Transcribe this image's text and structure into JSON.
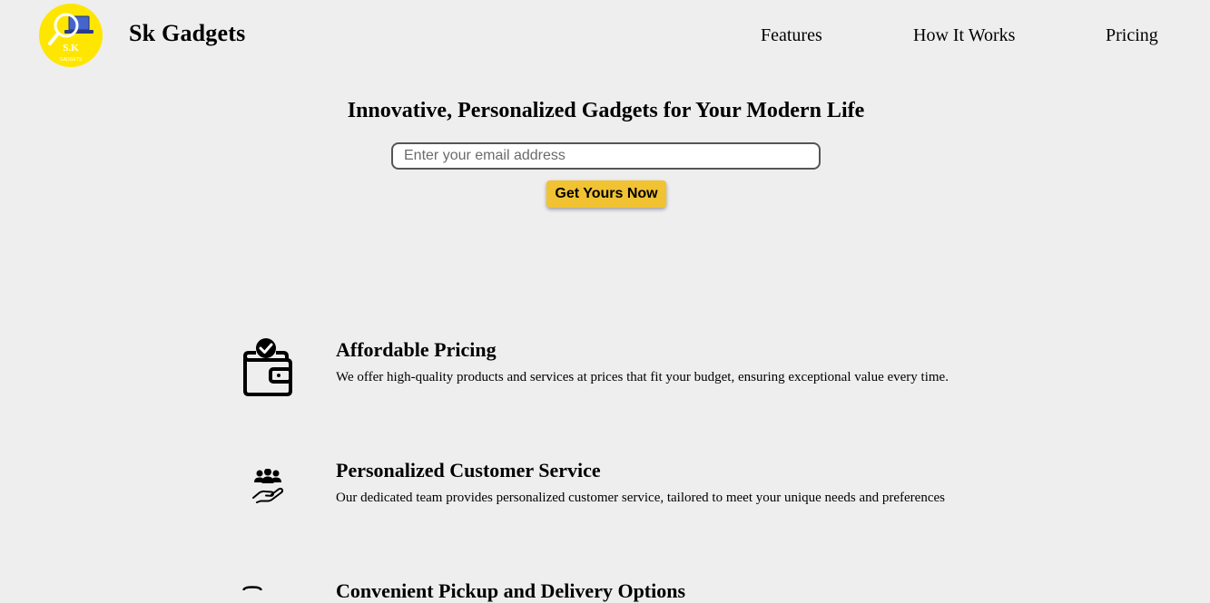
{
  "header": {
    "logo_text": "S.K",
    "logo_subtext": "GADGETS",
    "brand": "Sk Gadgets",
    "nav": [
      {
        "label": "Features"
      },
      {
        "label": "How It Works"
      },
      {
        "label": "Pricing"
      }
    ]
  },
  "hero": {
    "title": "Innovative, Personalized Gadgets for Your Modern Life",
    "email_placeholder": "Enter your email address",
    "email_value": "",
    "cta_label": "Get Yours Now"
  },
  "features": [
    {
      "icon": "wallet-check-icon",
      "title": "Affordable Pricing",
      "description": "We offer high-quality products and services at prices that fit your budget, ensuring exceptional value every time."
    },
    {
      "icon": "people-hand-icon",
      "title": "Personalized Customer Service",
      "description": "Our dedicated team provides personalized customer service, tailored to meet your unique needs and preferences"
    },
    {
      "icon": "clock-icon",
      "title": "Convenient Pickup and Delivery Options",
      "description": ""
    }
  ],
  "colors": {
    "background": "#eeeeee",
    "logo_yellow": "#ffe600",
    "cta_yellow": "#f1c232"
  }
}
